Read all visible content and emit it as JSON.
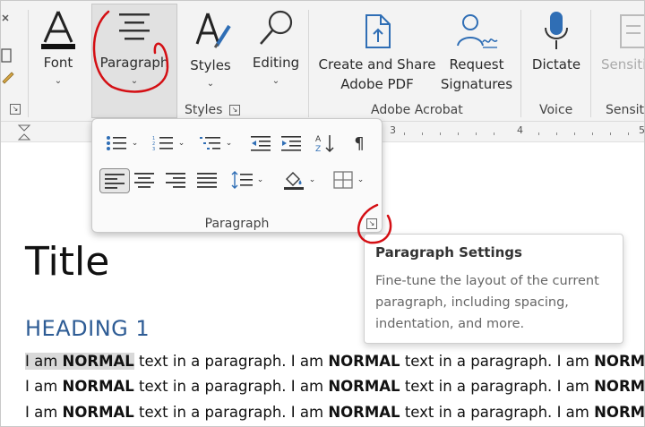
{
  "ribbon": {
    "font_label": "Font",
    "paragraph_label": "Paragraph",
    "styles_label": "Styles",
    "editing_label": "Editing",
    "create_share_line1": "Create and Share",
    "create_share_line2": "Adobe PDF",
    "request_line1": "Request",
    "request_line2": "Signatures",
    "dictate_label": "Dictate",
    "sensitivity_label": "Sensiti",
    "group_styles": "Styles",
    "group_adobe": "Adobe Acrobat",
    "group_voice": "Voice",
    "group_sensitivity": "Sensiti"
  },
  "ruler": {
    "numbers": [
      "3",
      "4",
      "5"
    ]
  },
  "paragraph_popup": {
    "label": "Paragraph",
    "pilcrow": "¶"
  },
  "tooltip": {
    "title": "Paragraph Settings",
    "description": "Fine-tune the layout of the current paragraph, including spacing, indentation, and more."
  },
  "document": {
    "title": "Title",
    "heading": "HEADING 1",
    "segments": {
      "i_am": "I am",
      "normal": "NORMAL",
      "rest": "text in a paragraph.",
      "tail": "I am",
      "tail_bold": "NORM"
    }
  },
  "colors": {
    "accent_blue": "#2e5c95",
    "annotation_red": "#d40f14"
  }
}
